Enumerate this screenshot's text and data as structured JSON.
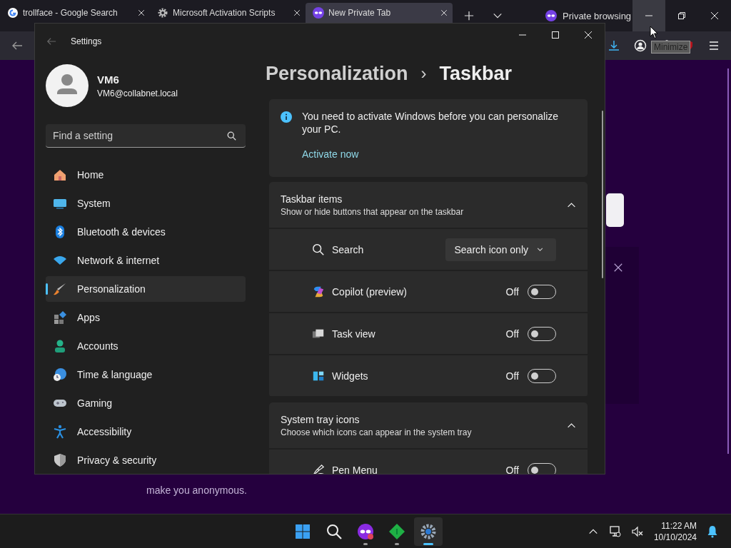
{
  "browser": {
    "tabs": [
      {
        "title": "trollface - Google Search",
        "selected": false
      },
      {
        "title": "Microsoft Activation Scripts",
        "selected": false
      },
      {
        "title": "New Private Tab",
        "selected": true
      }
    ],
    "private_label": "Private browsing",
    "tooltip": "Minimize",
    "page_text": "make you anonymous."
  },
  "settings": {
    "title": "Settings",
    "user": {
      "name": "VM6",
      "email": "VM6@collabnet.local"
    },
    "search": {
      "placeholder": "Find a setting"
    },
    "nav": [
      {
        "label": "Home",
        "selected": false
      },
      {
        "label": "System",
        "selected": false
      },
      {
        "label": "Bluetooth & devices",
        "selected": false
      },
      {
        "label": "Network & internet",
        "selected": false
      },
      {
        "label": "Personalization",
        "selected": true
      },
      {
        "label": "Apps",
        "selected": false
      },
      {
        "label": "Accounts",
        "selected": false
      },
      {
        "label": "Time & language",
        "selected": false
      },
      {
        "label": "Gaming",
        "selected": false
      },
      {
        "label": "Accessibility",
        "selected": false
      },
      {
        "label": "Privacy & security",
        "selected": false
      }
    ],
    "breadcrumb": {
      "parent": "Personalization",
      "separator": "›",
      "current": "Taskbar"
    },
    "notice": {
      "text": "You need to activate Windows before you can personalize your PC.",
      "link": "Activate now"
    },
    "sections": [
      {
        "title": "Taskbar items",
        "subtitle": "Show or hide buttons that appear on the taskbar",
        "expanded": true,
        "rows": [
          {
            "kind": "dropdown",
            "label": "Search",
            "value": "Search icon only"
          },
          {
            "kind": "toggle",
            "label": "Copilot (preview)",
            "state_text": "Off",
            "on": false
          },
          {
            "kind": "toggle",
            "label": "Task view",
            "state_text": "Off",
            "on": false
          },
          {
            "kind": "toggle",
            "label": "Widgets",
            "state_text": "Off",
            "on": false
          }
        ]
      },
      {
        "title": "System tray icons",
        "subtitle": "Choose which icons can appear in the system tray",
        "expanded": true,
        "rows": [
          {
            "kind": "toggle",
            "label": "Pen Menu",
            "state_text": "Off",
            "on": false
          }
        ]
      }
    ]
  },
  "taskbar": {
    "apps": [
      {
        "running": false,
        "selected": false
      },
      {
        "running": false,
        "selected": false
      },
      {
        "running": true,
        "selected": false
      },
      {
        "running": true,
        "selected": false
      },
      {
        "running": true,
        "selected": true
      }
    ],
    "time": "11:22 AM",
    "date": "10/10/2024"
  }
}
